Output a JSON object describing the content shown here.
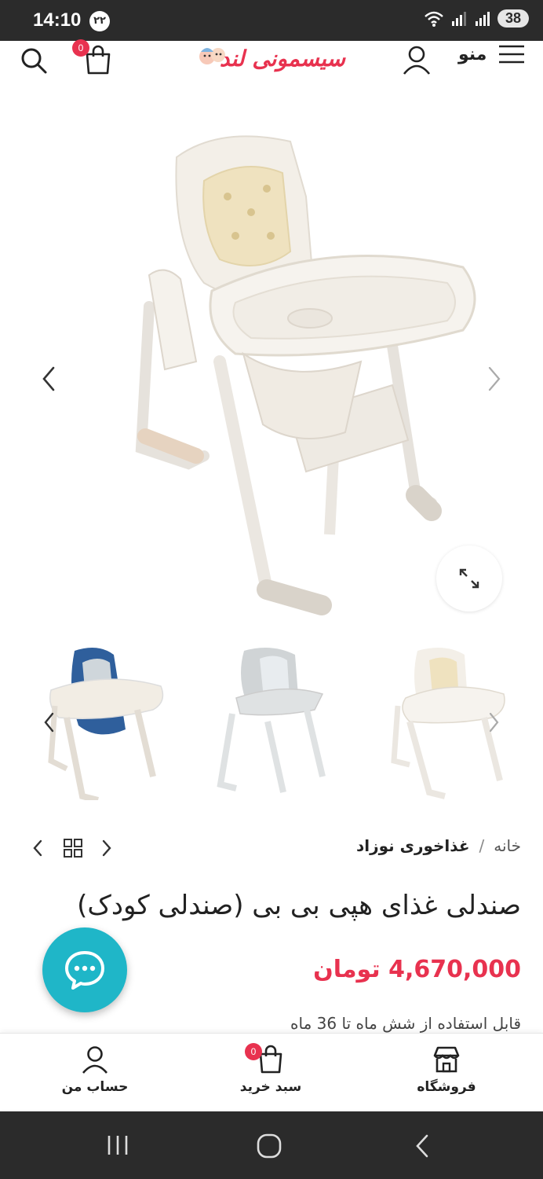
{
  "status_bar": {
    "time": "14:10",
    "notification_count": "۲۲",
    "battery": "38"
  },
  "header": {
    "logo_text": "سیسمونی لند",
    "menu_label": "منو",
    "cart_count": "0"
  },
  "gallery": {
    "thumbnails": [
      "cream-high-chair",
      "gray-high-chair",
      "blue-high-chair"
    ]
  },
  "breadcrumb": {
    "home": "خانه",
    "separator": "/",
    "current": "غذاخوری نوزاد"
  },
  "product": {
    "title": "صندلی غذای هپی بی بی (صندلی کودک)",
    "price": "4,670,000 تومان",
    "description": "قابل استفاده از شش ماه تا 36 ماه"
  },
  "bottom_nav": {
    "shop": "فروشگاه",
    "cart": "سبد خرید",
    "cart_count": "0",
    "account": "حساب من"
  },
  "colors": {
    "accent": "#e8324f",
    "chat": "#1fb6c8",
    "system_bar": "#2b2b2b"
  }
}
